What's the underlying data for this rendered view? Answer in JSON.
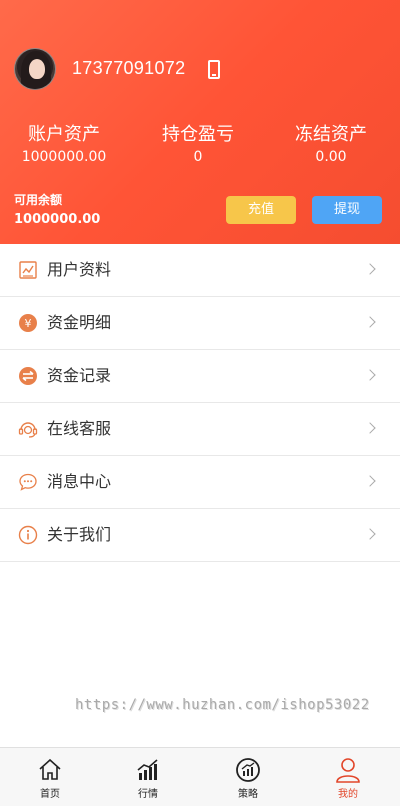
{
  "user": {
    "phone": "17377091072"
  },
  "stats": [
    {
      "label": "账户资产",
      "value": "1000000.00"
    },
    {
      "label": "持仓盈亏",
      "value": "0"
    },
    {
      "label": "冻结资产",
      "value": "0.00"
    }
  ],
  "available": {
    "label": "可用余额",
    "value": "1000000.00"
  },
  "buttons": {
    "recharge": "充值",
    "withdraw": "提现"
  },
  "menu": [
    {
      "label": "用户资料",
      "icon": "profile-icon"
    },
    {
      "label": "资金明细",
      "icon": "yuan-icon"
    },
    {
      "label": "资金记录",
      "icon": "transfer-icon"
    },
    {
      "label": "在线客服",
      "icon": "headset-icon"
    },
    {
      "label": "消息中心",
      "icon": "chat-icon"
    },
    {
      "label": "关于我们",
      "icon": "info-icon"
    }
  ],
  "watermark": "https://www.huzhan.com/ishop53022",
  "tabs": [
    {
      "label": "首页",
      "icon": "home-icon"
    },
    {
      "label": "行情",
      "icon": "chart-icon"
    },
    {
      "label": "策略",
      "icon": "strategy-icon"
    },
    {
      "label": "我的",
      "icon": "user-icon",
      "active": true
    }
  ],
  "colors": {
    "header_gradient": [
      "#ff6a4a",
      "#f54d30"
    ],
    "recharge": "#f7c64a",
    "withdraw": "#4fa5f5",
    "icon_accent": "#e8804a",
    "active_tab": "#e2462a"
  }
}
